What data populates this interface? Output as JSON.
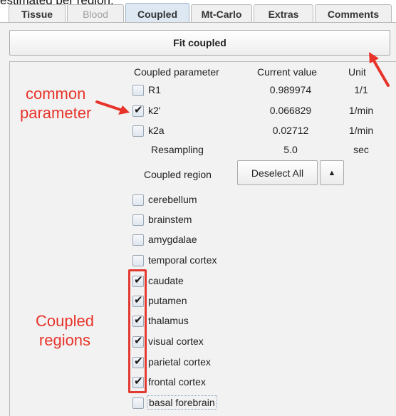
{
  "header_text": "estimated per region:",
  "tabs": [
    {
      "label": "Tissue",
      "state": "normal"
    },
    {
      "label": "Blood",
      "state": "disabled"
    },
    {
      "label": "Coupled",
      "state": "active"
    },
    {
      "label": "Mt-Carlo",
      "state": "normal"
    },
    {
      "label": "Extras",
      "state": "normal"
    },
    {
      "label": "Comments",
      "state": "normal"
    }
  ],
  "fit_button_label": "Fit coupled",
  "table": {
    "col_param": "Coupled parameter",
    "col_value": "Current value",
    "col_unit": "Unit",
    "params": [
      {
        "name": "R1",
        "checked": false,
        "value": "0.989974",
        "unit": "1/1"
      },
      {
        "name": "k2'",
        "checked": true,
        "value": "0.066829",
        "unit": "1/min"
      },
      {
        "name": "k2a",
        "checked": false,
        "value": "0.02712",
        "unit": "1/min"
      }
    ],
    "resampling_label": "Resampling",
    "resampling_value": "5.0",
    "resampling_unit": "sec"
  },
  "coupled_region_label": "Coupled region",
  "deselect_all_label": "Deselect All",
  "up_arrow_glyph": "▲",
  "regions": [
    {
      "name": "cerebellum",
      "checked": false
    },
    {
      "name": "brainstem",
      "checked": false
    },
    {
      "name": "amygdalae",
      "checked": false
    },
    {
      "name": "temporal cortex",
      "checked": false
    },
    {
      "name": "caudate",
      "checked": true
    },
    {
      "name": "putamen",
      "checked": true
    },
    {
      "name": "thalamus",
      "checked": true
    },
    {
      "name": "visual cortex",
      "checked": true
    },
    {
      "name": "parietal cortex",
      "checked": true
    },
    {
      "name": "frontal cortex",
      "checked": true
    },
    {
      "name": "basal forebrain",
      "checked": false
    }
  ],
  "annotations": {
    "common_line1": "common",
    "common_line2": "parameter",
    "coupled_line1": "Coupled",
    "coupled_line2": "regions",
    "color": "#e8332a"
  },
  "check_glyph": "✔"
}
